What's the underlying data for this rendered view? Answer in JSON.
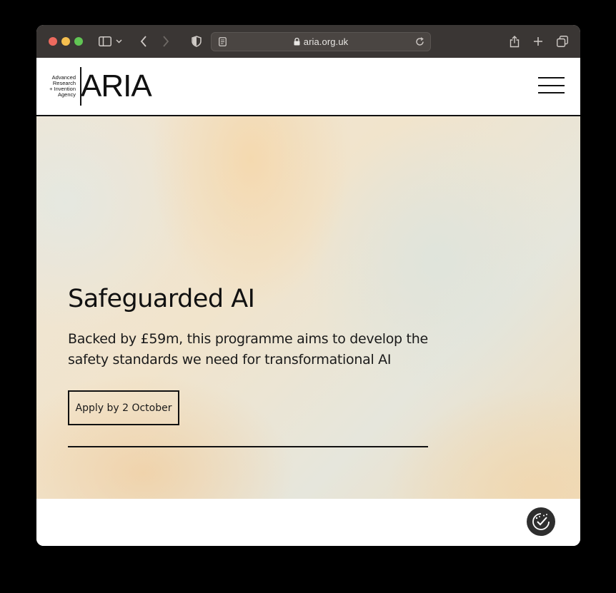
{
  "browser": {
    "url": "aria.org.uk"
  },
  "site": {
    "logo": {
      "small_lines": [
        "Advanced",
        "Research",
        "+ Invention",
        "Agency"
      ],
      "wordmark": "ARIA"
    }
  },
  "hero": {
    "title": "Safeguarded AI",
    "description": "Backed by £59m, this programme aims to develop the safety standards we need for transformational AI",
    "cta_label": "Apply by 2 October"
  },
  "colors": {
    "window_chrome": "#3a3634",
    "text": "#111111",
    "fab_background": "#2e2e2e"
  },
  "icons": {
    "fab": "cookie-consent-icon"
  }
}
